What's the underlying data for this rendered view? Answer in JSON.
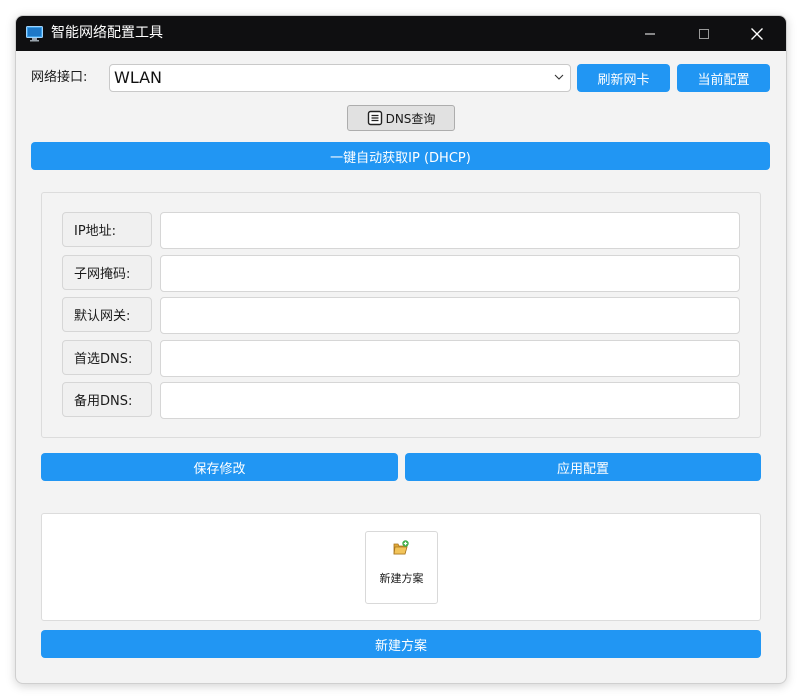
{
  "window": {
    "title": "智能网络配置工具"
  },
  "interface": {
    "label": "网络接口:",
    "selected": "WLAN",
    "refresh_button": "刷新网卡",
    "current_config_button": "当前配置"
  },
  "dns_query_button": "DNS查询",
  "dhcp_button": "一键自动获取IP (DHCP)",
  "fields": {
    "ip": {
      "label": "IP地址:",
      "value": ""
    },
    "subnet": {
      "label": "子网掩码:",
      "value": ""
    },
    "gateway": {
      "label": "默认网关:",
      "value": ""
    },
    "dns1": {
      "label": "首选DNS:",
      "value": ""
    },
    "dns2": {
      "label": "备用DNS:",
      "value": ""
    }
  },
  "actions": {
    "save": "保存修改",
    "apply": "应用配置"
  },
  "schemes": {
    "card_label": "新建方案",
    "new_button": "新建方案"
  },
  "colors": {
    "accent": "#2196f3",
    "titlebar": "#0f0f11",
    "window_bg": "#f3f3f3"
  },
  "icons": {
    "app": "monitor-icon",
    "minimize": "minimize-icon",
    "maximize": "maximize-icon",
    "close": "close-icon",
    "dropdown": "chevron-down-icon",
    "dns": "document-icon",
    "new_scheme": "folder-plus-icon"
  }
}
